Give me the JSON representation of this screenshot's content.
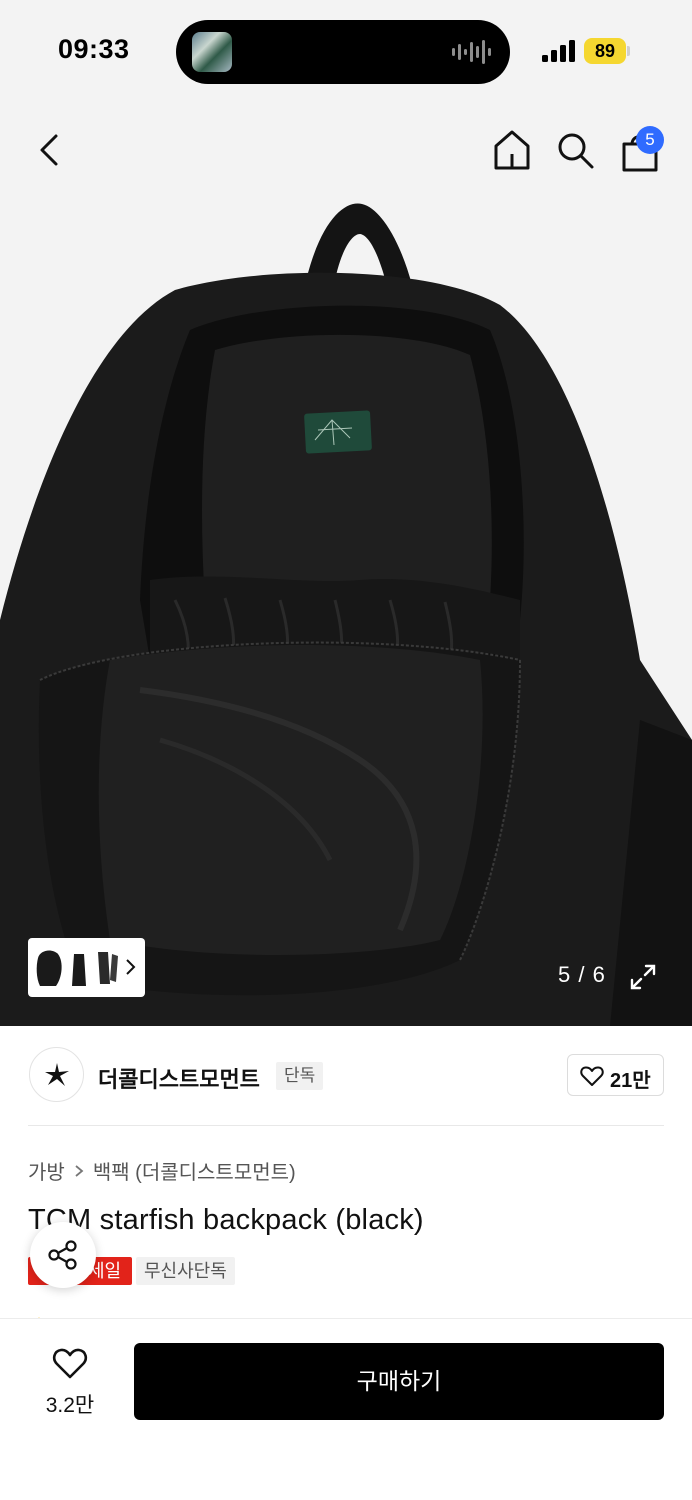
{
  "status": {
    "time": "09:33",
    "battery": "89",
    "accent": "#f5d730"
  },
  "header": {
    "back_icon": "chevron-left-icon",
    "home_icon": "home-icon",
    "search_icon": "search-icon",
    "cart_icon": "shopping-bag-icon",
    "cart_badge": "5",
    "badge_color": "#2f6bff"
  },
  "gallery": {
    "counter": "5 / 6",
    "expand_icon": "expand-icon"
  },
  "brand": {
    "name": "더콜디스트모먼트",
    "tag": "단독",
    "likes": "21만"
  },
  "product": {
    "breadcrumb": [
      "가방",
      "백팩 (더콜디스트모먼트)"
    ],
    "title": "TCM starfish backpack (black)",
    "sale_badge": "세일",
    "exclusive_badge": "무신사단독",
    "sale_color": "#e2231a"
  },
  "bottom": {
    "wish_count": "3.2만",
    "buy_label": "구매하기"
  }
}
